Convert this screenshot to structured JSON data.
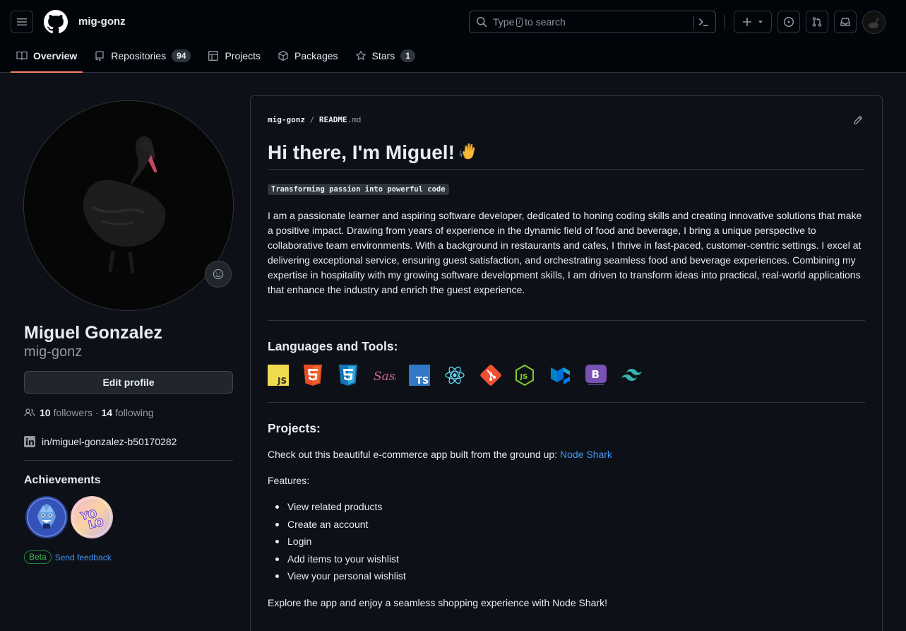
{
  "header": {
    "username": "mig-gonz",
    "search_placeholder_before": "Type",
    "search_key": "/",
    "search_placeholder_after": "to search"
  },
  "tabs": [
    {
      "label": "Overview",
      "icon": "book-icon"
    },
    {
      "label": "Repositories",
      "icon": "repo-icon",
      "count": "94"
    },
    {
      "label": "Projects",
      "icon": "table-icon"
    },
    {
      "label": "Packages",
      "icon": "package-icon"
    },
    {
      "label": "Stars",
      "icon": "star-icon",
      "count": "1"
    }
  ],
  "profile": {
    "full_name": "Miguel Gonzalez",
    "login": "mig-gonz",
    "edit_label": "Edit profile",
    "followers_count": "10",
    "followers_label": "followers",
    "following_count": "14",
    "following_label": "following",
    "linkedin": "in/miguel-gonzalez-b50170282",
    "achievements_title": "Achievements",
    "beta_label": "Beta",
    "feedback_label": "Send feedback"
  },
  "readme": {
    "owner": "mig-gonz",
    "filename": "README",
    "ext": ".md",
    "heading": "Hi there, I'm Miguel!",
    "heading_emoji": "👋",
    "tagline": "Transforming passion into powerful code",
    "intro": "I am a passionate learner and aspiring software developer, dedicated to honing coding skills and creating innovative solutions that make a positive impact. Drawing from years of experience in the dynamic field of food and beverage, I bring a unique perspective to collaborative team environments. With a background in restaurants and cafes, I thrive in fast-paced, customer-centric settings. I excel at delivering exceptional service, ensuring guest satisfaction, and orchestrating seamless food and beverage experiences. Combining my expertise in hospitality with my growing software development skills, I am driven to transform ideas into practical, real-world applications that enhance the industry and enrich the guest experience.",
    "tools_heading": "Languages and Tools:",
    "tools": [
      "javascript-icon",
      "html5-icon",
      "css3-icon",
      "sass-icon",
      "typescript-icon",
      "react-icon",
      "git-icon",
      "nodejs-icon",
      "mui-icon",
      "bootstrap-icon",
      "tailwind-icon"
    ],
    "projects_heading": "Projects:",
    "project_text": "Check out this beautiful e-commerce app built from the ground up:",
    "project_link": "Node Shark",
    "features_label": "Features:",
    "features": [
      "View related products",
      "Create an account",
      "Login",
      "Add items to your wishlist",
      "View your personal wishlist"
    ],
    "closing": "Explore the app and enjoy a seamless shopping experience with Node Shark!"
  }
}
